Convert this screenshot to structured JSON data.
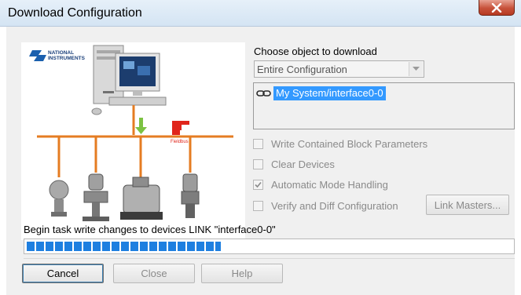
{
  "window": {
    "title": "Download Configuration"
  },
  "object_selector": {
    "label": "Choose object to download",
    "selected_value": "Entire Configuration"
  },
  "object_list": {
    "items": [
      {
        "label": "My System/interface0-0",
        "selected": true
      }
    ]
  },
  "options": [
    {
      "label": "Write Contained Block Parameters",
      "checked": false
    },
    {
      "label": "Clear Devices",
      "checked": false
    },
    {
      "label": "Automatic Mode Handling",
      "checked": true
    },
    {
      "label": "Verify and Diff Configuration",
      "checked": false
    }
  ],
  "buttons": {
    "link_masters": "Link Masters...",
    "cancel": "Cancel",
    "close": "Close",
    "help": "Help"
  },
  "status": {
    "message": "Begin task write changes to devices LINK \"interface0-0\"",
    "progress_fraction": 0.4
  },
  "illustration": {
    "logo_text": [
      "NATIONAL",
      "INSTRUMENTS"
    ],
    "fieldbus_label": "Fieldbus",
    "bus_color": "#e57c22"
  },
  "colors": {
    "selection": "#3399ff",
    "progress": "#1e7fe0",
    "close_button": "#c7513a"
  }
}
